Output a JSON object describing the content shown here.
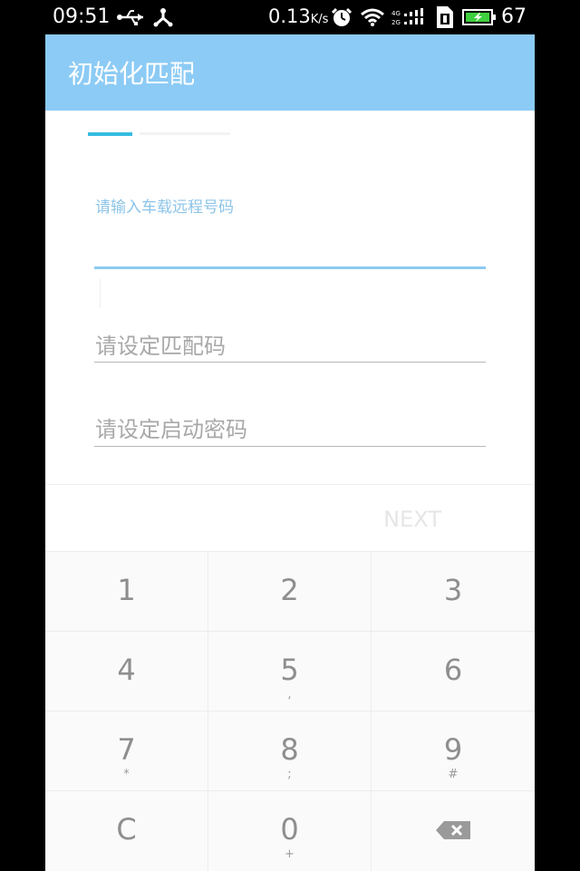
{
  "status_bar": {
    "time": "09:51",
    "network_speed": "0.13",
    "network_speed_unit": "K/s",
    "battery_level": "67",
    "icons": [
      "usb-icon",
      "usb-debug-icon",
      "alarm-icon",
      "wifi-icon",
      "signal-icon",
      "sim-icon",
      "battery-charging-icon"
    ]
  },
  "dialog": {
    "title": "初始化匹配",
    "fields": [
      {
        "hint": "请输入车载远程号码",
        "value": ""
      },
      {
        "placeholder": "请设定匹配码"
      },
      {
        "placeholder": "请设定启动密码"
      }
    ],
    "next_label": "NEXT"
  },
  "keypad": {
    "keys": [
      {
        "digit": "1",
        "sub": ""
      },
      {
        "digit": "2",
        "sub": ""
      },
      {
        "digit": "3",
        "sub": ""
      },
      {
        "digit": "4",
        "sub": ""
      },
      {
        "digit": "5",
        "sub": ","
      },
      {
        "digit": "6",
        "sub": ""
      },
      {
        "digit": "7",
        "sub": "*"
      },
      {
        "digit": "8",
        "sub": ";"
      },
      {
        "digit": "9",
        "sub": "#"
      },
      {
        "digit": "C",
        "sub": ""
      },
      {
        "digit": "0",
        "sub": "+"
      },
      {
        "icon": "backspace-icon"
      }
    ]
  },
  "colors": {
    "title_bar": "#8ccbf5",
    "accent": "#36bce0",
    "hint_text": "#8cc4e8"
  }
}
